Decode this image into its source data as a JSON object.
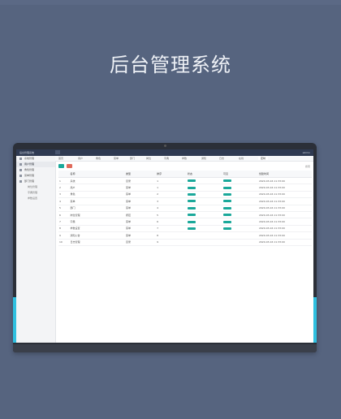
{
  "hero": {
    "title": "后台管理系统"
  },
  "app": {
    "brand": "后台管理系统",
    "user": "admin",
    "sidebar": [
      {
        "label": "系统管理",
        "sub": false
      },
      {
        "label": "用户管理",
        "sub": false
      },
      {
        "label": "角色管理",
        "sub": false
      },
      {
        "label": "菜单管理",
        "sub": false
      },
      {
        "label": "部门管理",
        "sub": false
      },
      {
        "label": "岗位管理",
        "sub": true
      },
      {
        "label": "字典管理",
        "sub": true
      },
      {
        "label": "参数设置",
        "sub": true
      }
    ],
    "tabs": [
      "首页",
      "用户",
      "角色",
      "菜单",
      "部门",
      "岗位",
      "字典",
      "参数",
      "通知",
      "日志",
      "在线",
      "定时"
    ],
    "toolbar_right": "搜索",
    "columns": [
      "",
      "名称",
      "类型",
      "排序",
      "状态",
      "可见",
      "创建时间"
    ],
    "rows": [
      [
        "1",
        "系统",
        "目录",
        "1",
        "",
        "",
        "2020-03-16 11:33:00"
      ],
      [
        "2",
        "用户",
        "菜单",
        "1",
        "",
        "",
        "2020-03-16 11:33:00"
      ],
      [
        "3",
        "角色",
        "菜单",
        "2",
        "",
        "",
        "2020-03-16 11:33:00"
      ],
      [
        "4",
        "菜单",
        "菜单",
        "3",
        "",
        "",
        "2020-03-16 11:33:00"
      ],
      [
        "5",
        "部门",
        "菜单",
        "4",
        "",
        "",
        "2020-03-16 11:33:00"
      ],
      [
        "6",
        "岗位管理",
        "按钮",
        "5",
        "",
        "",
        "2020-03-16 11:33:00"
      ],
      [
        "7",
        "字典",
        "菜单",
        "6",
        "",
        "",
        "2020-03-16 11:33:00"
      ],
      [
        "8",
        "参数设置",
        "菜单",
        "7",
        "",
        "",
        "2020-03-16 11:33:00"
      ],
      [
        "9",
        "通知公告",
        "菜单",
        "8",
        "",
        "",
        "2020-03-16 11:33:00"
      ],
      [
        "10",
        "日志管理",
        "目录",
        "9",
        "",
        "",
        "2020-03-16 11:33:00"
      ]
    ]
  },
  "colors": {
    "background": "#56647f",
    "accent": "#1aa89a",
    "header": "#2f3a52"
  }
}
